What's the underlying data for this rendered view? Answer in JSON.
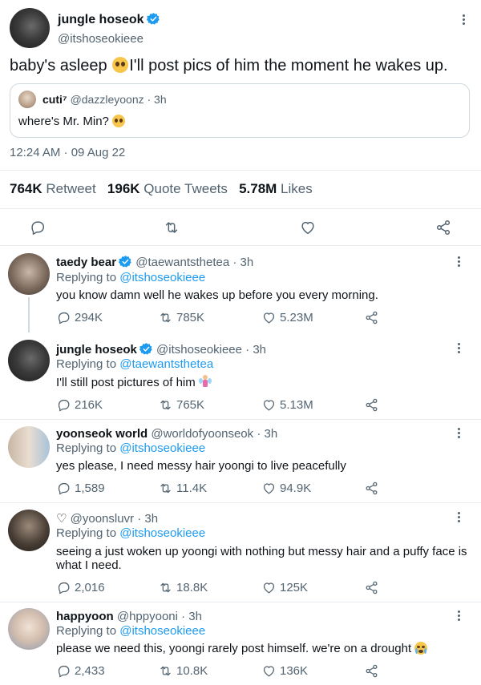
{
  "main_tweet": {
    "display_name": "jungle hoseok",
    "handle": "@itshoseokieee",
    "text": "baby's asleep",
    "text_after_emoji": "I'll post pics of him the moment he wakes up.",
    "quoted": {
      "display_name": "cuti⁷",
      "handle": "@dazzleyoonz",
      "time": "· 3h",
      "text": "where's Mr. Min?"
    },
    "timestamp": "12:24 AM · 09 Aug 22",
    "stats": {
      "retweets_value": "764K",
      "retweets_label": "Retweet",
      "quotes_value": "196K",
      "quotes_label": "Quote Tweets",
      "likes_value": "5.78M",
      "likes_label": "Likes"
    }
  },
  "replies": [
    {
      "display_name": "taedy bear",
      "handle": "@taewantsthetea",
      "time": "· 3h",
      "replying_prefix": "Replying to",
      "replying_to": "@itshoseokieee",
      "text": "you know damn well he wakes up before you every morning.",
      "replies": "294K",
      "retweets": "785K",
      "likes": "5.23M"
    },
    {
      "display_name": "jungle hoseok",
      "handle": "@itshoseokieee",
      "time": "· 3h",
      "replying_prefix": "Replying to",
      "replying_to": "@taewantsthetea",
      "text": "I'll still post pictures of him",
      "replies": "216K",
      "retweets": "765K",
      "likes": "5.13M"
    },
    {
      "display_name": "yoonseok world",
      "handle": "@worldofyoonseok",
      "time": "· 3h",
      "replying_prefix": "Replying to",
      "replying_to": "@itshoseokieee",
      "text": "yes please, I need messy hair yoongi to live peacefully",
      "replies": "1,589",
      "retweets": "11.4K",
      "likes": "94.9K"
    },
    {
      "display_name": "♡",
      "handle": "@yoonsluvr",
      "time": "· 3h",
      "replying_prefix": "Replying to",
      "replying_to": "@itshoseokieee",
      "text": "seeing a just woken up yoongi with nothing but messy hair and a puffy face is",
      "text_line2": "what I need.",
      "replies": "2,016",
      "retweets": "18.8K",
      "likes": "125K"
    },
    {
      "display_name": "happyoon",
      "handle": "@hppyooni",
      "time": "· 3h",
      "replying_prefix": "Replying to",
      "replying_to": "@itshoseokieee",
      "text": "please we need this, yoongi rarely post himself. we're on a drought",
      "replies": "2,433",
      "retweets": "10.8K",
      "likes": "136K"
    }
  ],
  "colors": {
    "link": "#1d9bf0",
    "verified": "#1d9bf0",
    "muted": "#536471",
    "text": "#0f1419"
  }
}
